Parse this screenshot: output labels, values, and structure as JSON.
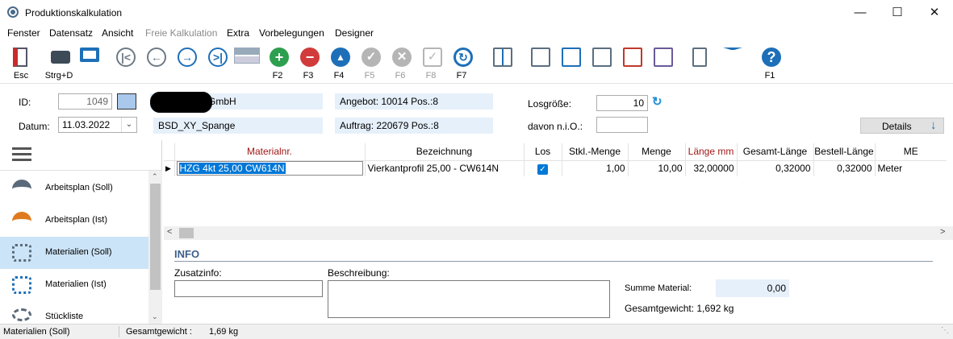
{
  "window": {
    "title": "Produktionskalkulation",
    "minimize": "—",
    "maximize": "☐",
    "close": "✕"
  },
  "menu": [
    {
      "label": "Fenster",
      "disabled": false
    },
    {
      "label": "Datensatz",
      "disabled": false
    },
    {
      "label": "Ansicht",
      "disabled": false
    },
    {
      "label": "Freie Kalkulation",
      "disabled": true
    },
    {
      "label": "Extra",
      "disabled": false
    },
    {
      "label": "Vorbelegungen",
      "disabled": false
    },
    {
      "label": "Designer",
      "disabled": false
    }
  ],
  "toolbar": {
    "esc": "Esc",
    "print": "Strg+D",
    "f2": "F2",
    "f3": "F3",
    "f4": "F4",
    "f5": "F5",
    "f6": "F6",
    "f8": "F8",
    "f7": "F7",
    "f1": "F1"
  },
  "header": {
    "id_label": "ID:",
    "id_value": "1049",
    "company_suffix": "GmbH",
    "angebot": "Angebot: 10014 Pos.:8",
    "losgroesse_label": "Losgröße:",
    "losgroesse_value": "10",
    "datum_label": "Datum:",
    "datum_value": "11.03.2022",
    "project": "BSD_XY_Spange",
    "auftrag": "Auftrag: 220679 Pos.:8",
    "nio_label": "davon n.i.O.:",
    "nio_value": "",
    "details_label": "Details"
  },
  "sidebar": {
    "items": [
      {
        "label": "Arbeitsplan (Soll)",
        "icon": "helmet-plan-icon"
      },
      {
        "label": "Arbeitsplan (Ist)",
        "icon": "helmet-plan-icon"
      },
      {
        "label": "Materialien (Soll)",
        "icon": "bolts-icon"
      },
      {
        "label": "Materialien (Ist)",
        "icon": "bolts-icon"
      },
      {
        "label": "Stückliste",
        "icon": "gears-icon"
      }
    ]
  },
  "grid": {
    "columns": [
      "Materialnr.",
      "Bezeichnung",
      "Los",
      "Stkl.-Menge",
      "Menge",
      "Länge mm",
      "Gesamt-Länge",
      "Bestell-Länge",
      "ME"
    ],
    "rows": [
      {
        "materialnr": "HZG 4kt 25,00 CW614N",
        "bezeichnung": "Vierkantprofil 25,00 - CW614N",
        "los": true,
        "stkl_menge": "1,00",
        "menge": "10,00",
        "laenge_mm": "32,00000",
        "gesamt_laenge": "0,32000",
        "bestell_laenge": "0,32000",
        "me": "Meter"
      }
    ]
  },
  "info": {
    "title": "INFO",
    "zusatzinfo_label": "Zusatzinfo:",
    "beschreibung_label": "Beschreibung:",
    "summe_label": "Summe Material:",
    "summe_value": "0,00",
    "gesamtgewicht": "Gesamtgewicht: 1,692 kg"
  },
  "status": {
    "view": "Materialien (Soll)",
    "gewicht_label": "Gesamtgewicht :",
    "gewicht_value": "1,69 kg"
  },
  "colors": {
    "accent": "#0078d7",
    "selection": "#cce4f7",
    "readonly": "#e6f0fa",
    "redText": "#a11818"
  }
}
